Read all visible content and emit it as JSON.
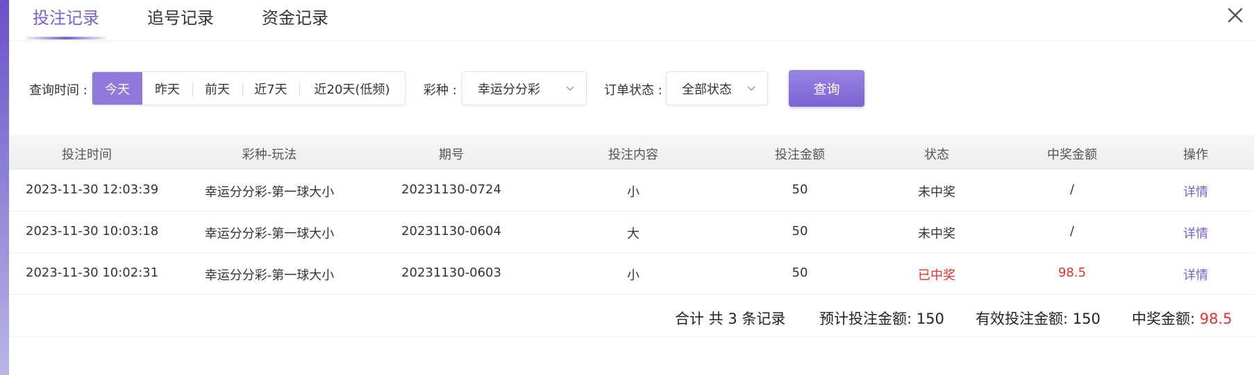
{
  "tabs": [
    {
      "label": "投注记录",
      "active": true
    },
    {
      "label": "追号记录",
      "active": false
    },
    {
      "label": "资金记录",
      "active": false
    }
  ],
  "close_icon": "close-icon",
  "filters": {
    "time_label": "查询时间 :",
    "time_options": [
      "今天",
      "昨天",
      "前天",
      "近7天",
      "近20天(低频)"
    ],
    "time_selected": "今天",
    "lottery_label": "彩种 :",
    "lottery_value": "幸运分分彩",
    "status_label": "订单状态 :",
    "status_value": "全部状态",
    "query_label": "查询"
  },
  "table": {
    "columns": [
      "投注时间",
      "彩种-玩法",
      "期号",
      "投注内容",
      "投注金额",
      "状态",
      "中奖金额",
      "操作"
    ],
    "rows": [
      {
        "time": "2023-11-30 12:03:39",
        "game": "幸运分分彩-第一球大小",
        "issue": "20231130-0724",
        "content": "小",
        "amount": "50",
        "status": "未中奖",
        "prize": "/",
        "action": "详情",
        "won": false
      },
      {
        "time": "2023-11-30 10:03:18",
        "game": "幸运分分彩-第一球大小",
        "issue": "20231130-0604",
        "content": "大",
        "amount": "50",
        "status": "未中奖",
        "prize": "/",
        "action": "详情",
        "won": false
      },
      {
        "time": "2023-11-30 10:02:31",
        "game": "幸运分分彩-第一球大小",
        "issue": "20231130-0603",
        "content": "小",
        "amount": "50",
        "status": "已中奖",
        "prize": "98.5",
        "action": "详情",
        "won": true
      }
    ]
  },
  "summary": {
    "total_text": "合计 共 3 条记录",
    "expected_label": "预计投注金额:",
    "expected_value": "150",
    "valid_label": "有效投注金额:",
    "valid_value": "150",
    "prize_label": "中奖金额:",
    "prize_value": "98.5"
  },
  "colors": {
    "accent": "#7a5fd4",
    "win": "#e8322b"
  }
}
